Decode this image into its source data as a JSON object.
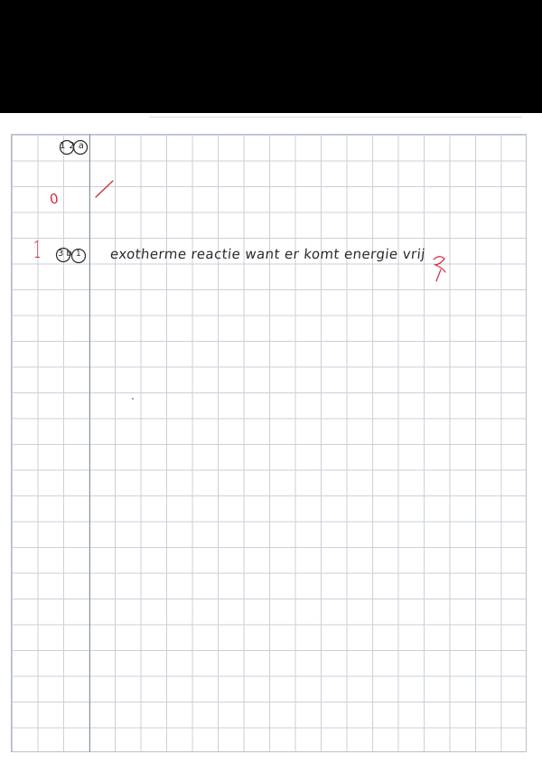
{
  "questions": [
    {
      "label": "12a",
      "score": "0"
    },
    {
      "label": "3b",
      "subnumber": "1",
      "score": "1",
      "answer": "exotherme reactie want er komt energie vrij"
    }
  ],
  "colors": {
    "ink": "#2a2a2a",
    "correction": "#d12a3a",
    "grid": "#c9d1da",
    "margin": "#8a939c",
    "redaction": "#000000"
  }
}
